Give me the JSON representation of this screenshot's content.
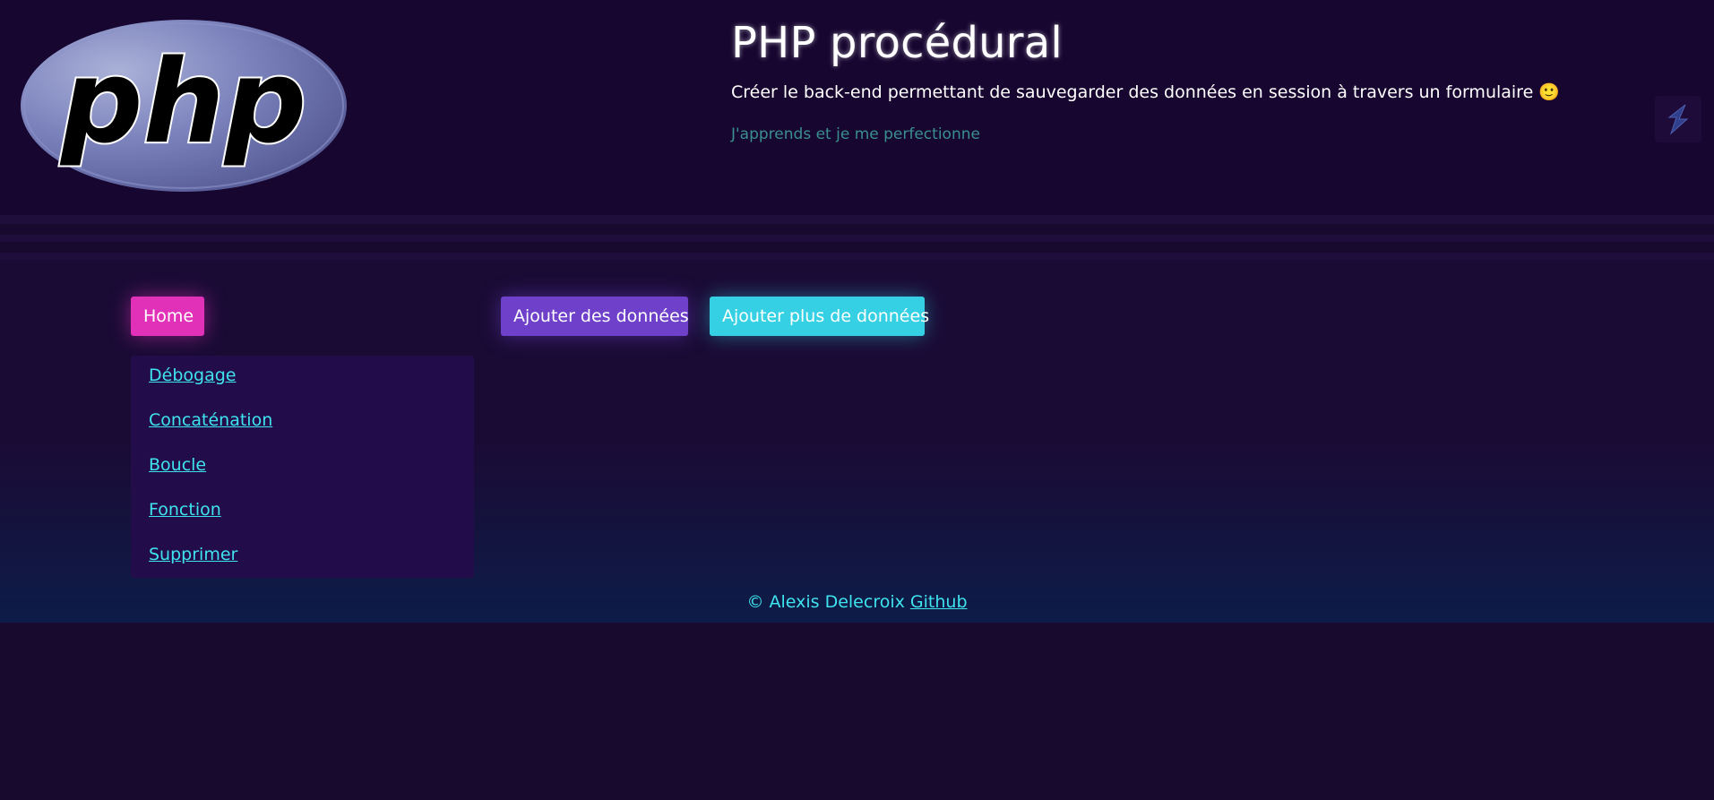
{
  "header": {
    "logo_text": "php",
    "title": "PHP procédural",
    "subtitle": "Créer le back-end permettant de sauvegarder des données en session à travers un formulaire",
    "subtitle_emoji": "🙂",
    "tagline": "J'apprends et je me perfectionne",
    "corner_icon": "lightning-icon"
  },
  "nav": {
    "home_label": "Home",
    "add_label": "Ajouter des données",
    "add_more_label": "Ajouter plus de données"
  },
  "sidebar": {
    "items": [
      {
        "label": "Débogage"
      },
      {
        "label": "Concaténation"
      },
      {
        "label": "Boucle"
      },
      {
        "label": "Fonction"
      },
      {
        "label": "Supprimer"
      }
    ]
  },
  "footer": {
    "text": "© Alexis Delecroix",
    "link": "Github"
  },
  "colors": {
    "background": "#180a2e",
    "home_button": "#e131b9",
    "add_button": "#6f40c9",
    "add_more_button": "#35d0e4",
    "link": "#3fe3ee",
    "tagline": "#3a8f8f"
  }
}
